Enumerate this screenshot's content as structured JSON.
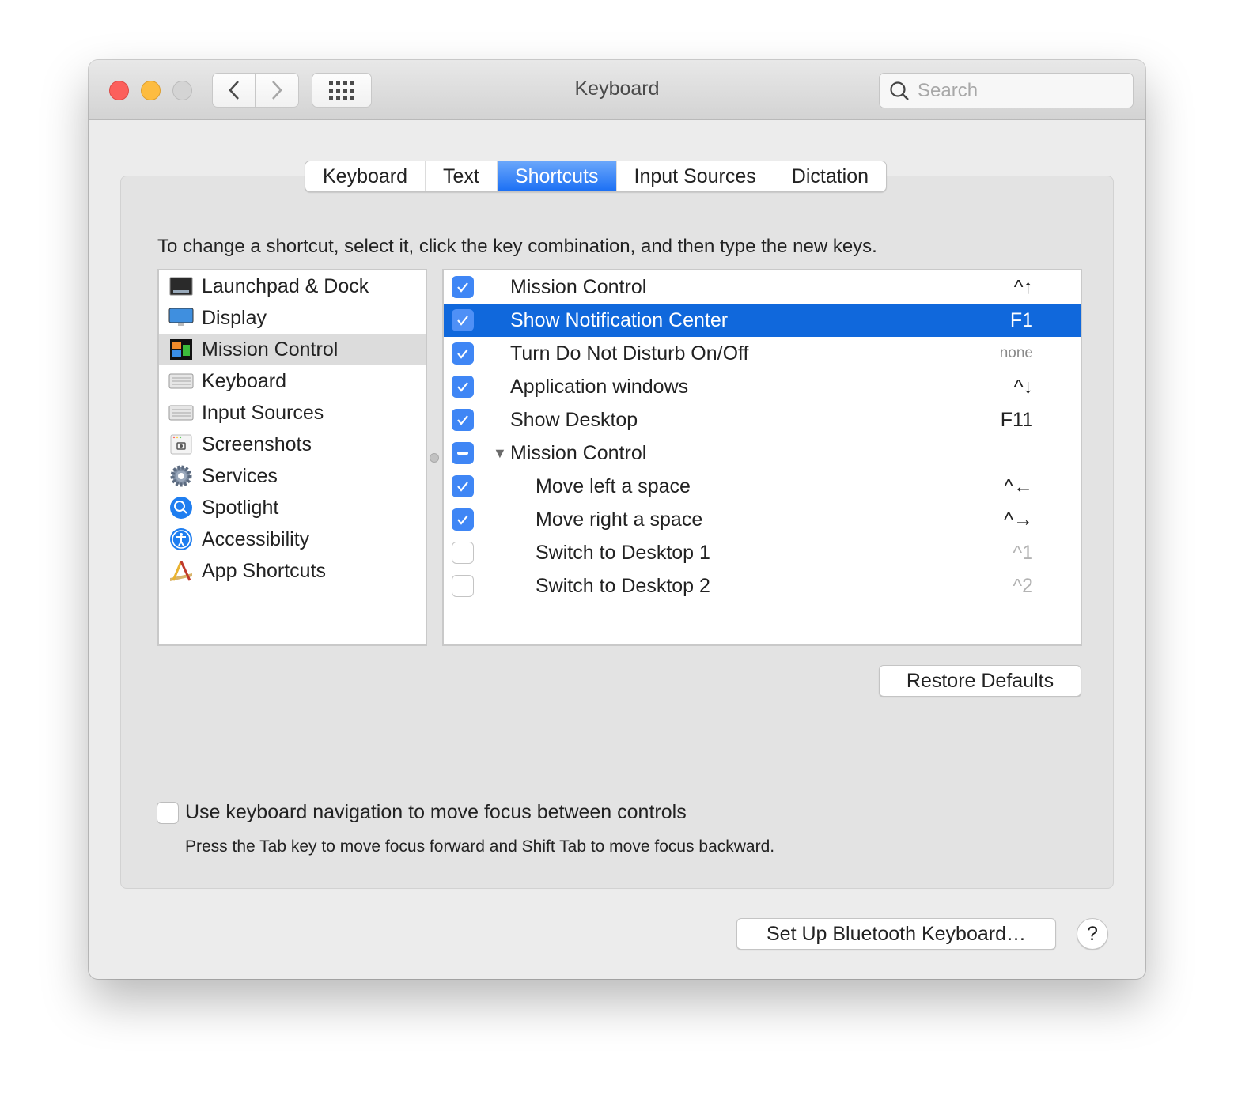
{
  "window": {
    "title": "Keyboard",
    "search_placeholder": "Search"
  },
  "tabs": [
    {
      "label": "Keyboard",
      "active": false
    },
    {
      "label": "Text",
      "active": false
    },
    {
      "label": "Shortcuts",
      "active": true
    },
    {
      "label": "Input Sources",
      "active": false
    },
    {
      "label": "Dictation",
      "active": false
    }
  ],
  "instructions": "To change a shortcut, select it, click the key combination, and then type the new keys.",
  "categories": [
    {
      "label": "Launchpad & Dock",
      "icon": "launchpad-dock-icon"
    },
    {
      "label": "Display",
      "icon": "display-icon"
    },
    {
      "label": "Mission Control",
      "icon": "mission-control-icon",
      "selected": true
    },
    {
      "label": "Keyboard",
      "icon": "keyboard-icon"
    },
    {
      "label": "Input Sources",
      "icon": "input-sources-icon"
    },
    {
      "label": "Screenshots",
      "icon": "screenshots-icon"
    },
    {
      "label": "Services",
      "icon": "services-gear-icon"
    },
    {
      "label": "Spotlight",
      "icon": "spotlight-icon"
    },
    {
      "label": "Accessibility",
      "icon": "accessibility-icon"
    },
    {
      "label": "App Shortcuts",
      "icon": "app-shortcuts-icon"
    }
  ],
  "shortcuts": [
    {
      "label": "Mission Control",
      "key": "^↑",
      "state": "checked"
    },
    {
      "label": "Show Notification Center",
      "key": "F1",
      "state": "checked",
      "selected": true
    },
    {
      "label": "Turn Do Not Disturb On/Off",
      "key": "none",
      "state": "checked"
    },
    {
      "label": "Application windows",
      "key": "^↓",
      "state": "checked"
    },
    {
      "label": "Show Desktop",
      "key": "F11",
      "state": "checked"
    },
    {
      "label": "Mission Control",
      "key": "",
      "state": "mixed",
      "group": true,
      "expanded": true
    },
    {
      "label": "Move left a space",
      "key": "^←",
      "state": "checked",
      "indent": true
    },
    {
      "label": "Move right a space",
      "key": "^→",
      "state": "checked",
      "indent": true
    },
    {
      "label": "Switch to Desktop 1",
      "key": "^1",
      "state": "unchecked",
      "indent": true
    },
    {
      "label": "Switch to Desktop 2",
      "key": "^2",
      "state": "unchecked",
      "indent": true
    }
  ],
  "buttons": {
    "restore_defaults": "Restore Defaults",
    "bluetooth": "Set Up Bluetooth Keyboard…",
    "help": "?"
  },
  "keyboard_navigation": {
    "label": "Use keyboard navigation to move focus between controls",
    "description": "Press the Tab key to move focus forward and Shift Tab to move focus backward.",
    "checked": false
  },
  "colors": {
    "accent": "#1068dc",
    "checkbox": "#3f86f5",
    "close": "#fc605c",
    "minimize": "#fdbc40"
  }
}
